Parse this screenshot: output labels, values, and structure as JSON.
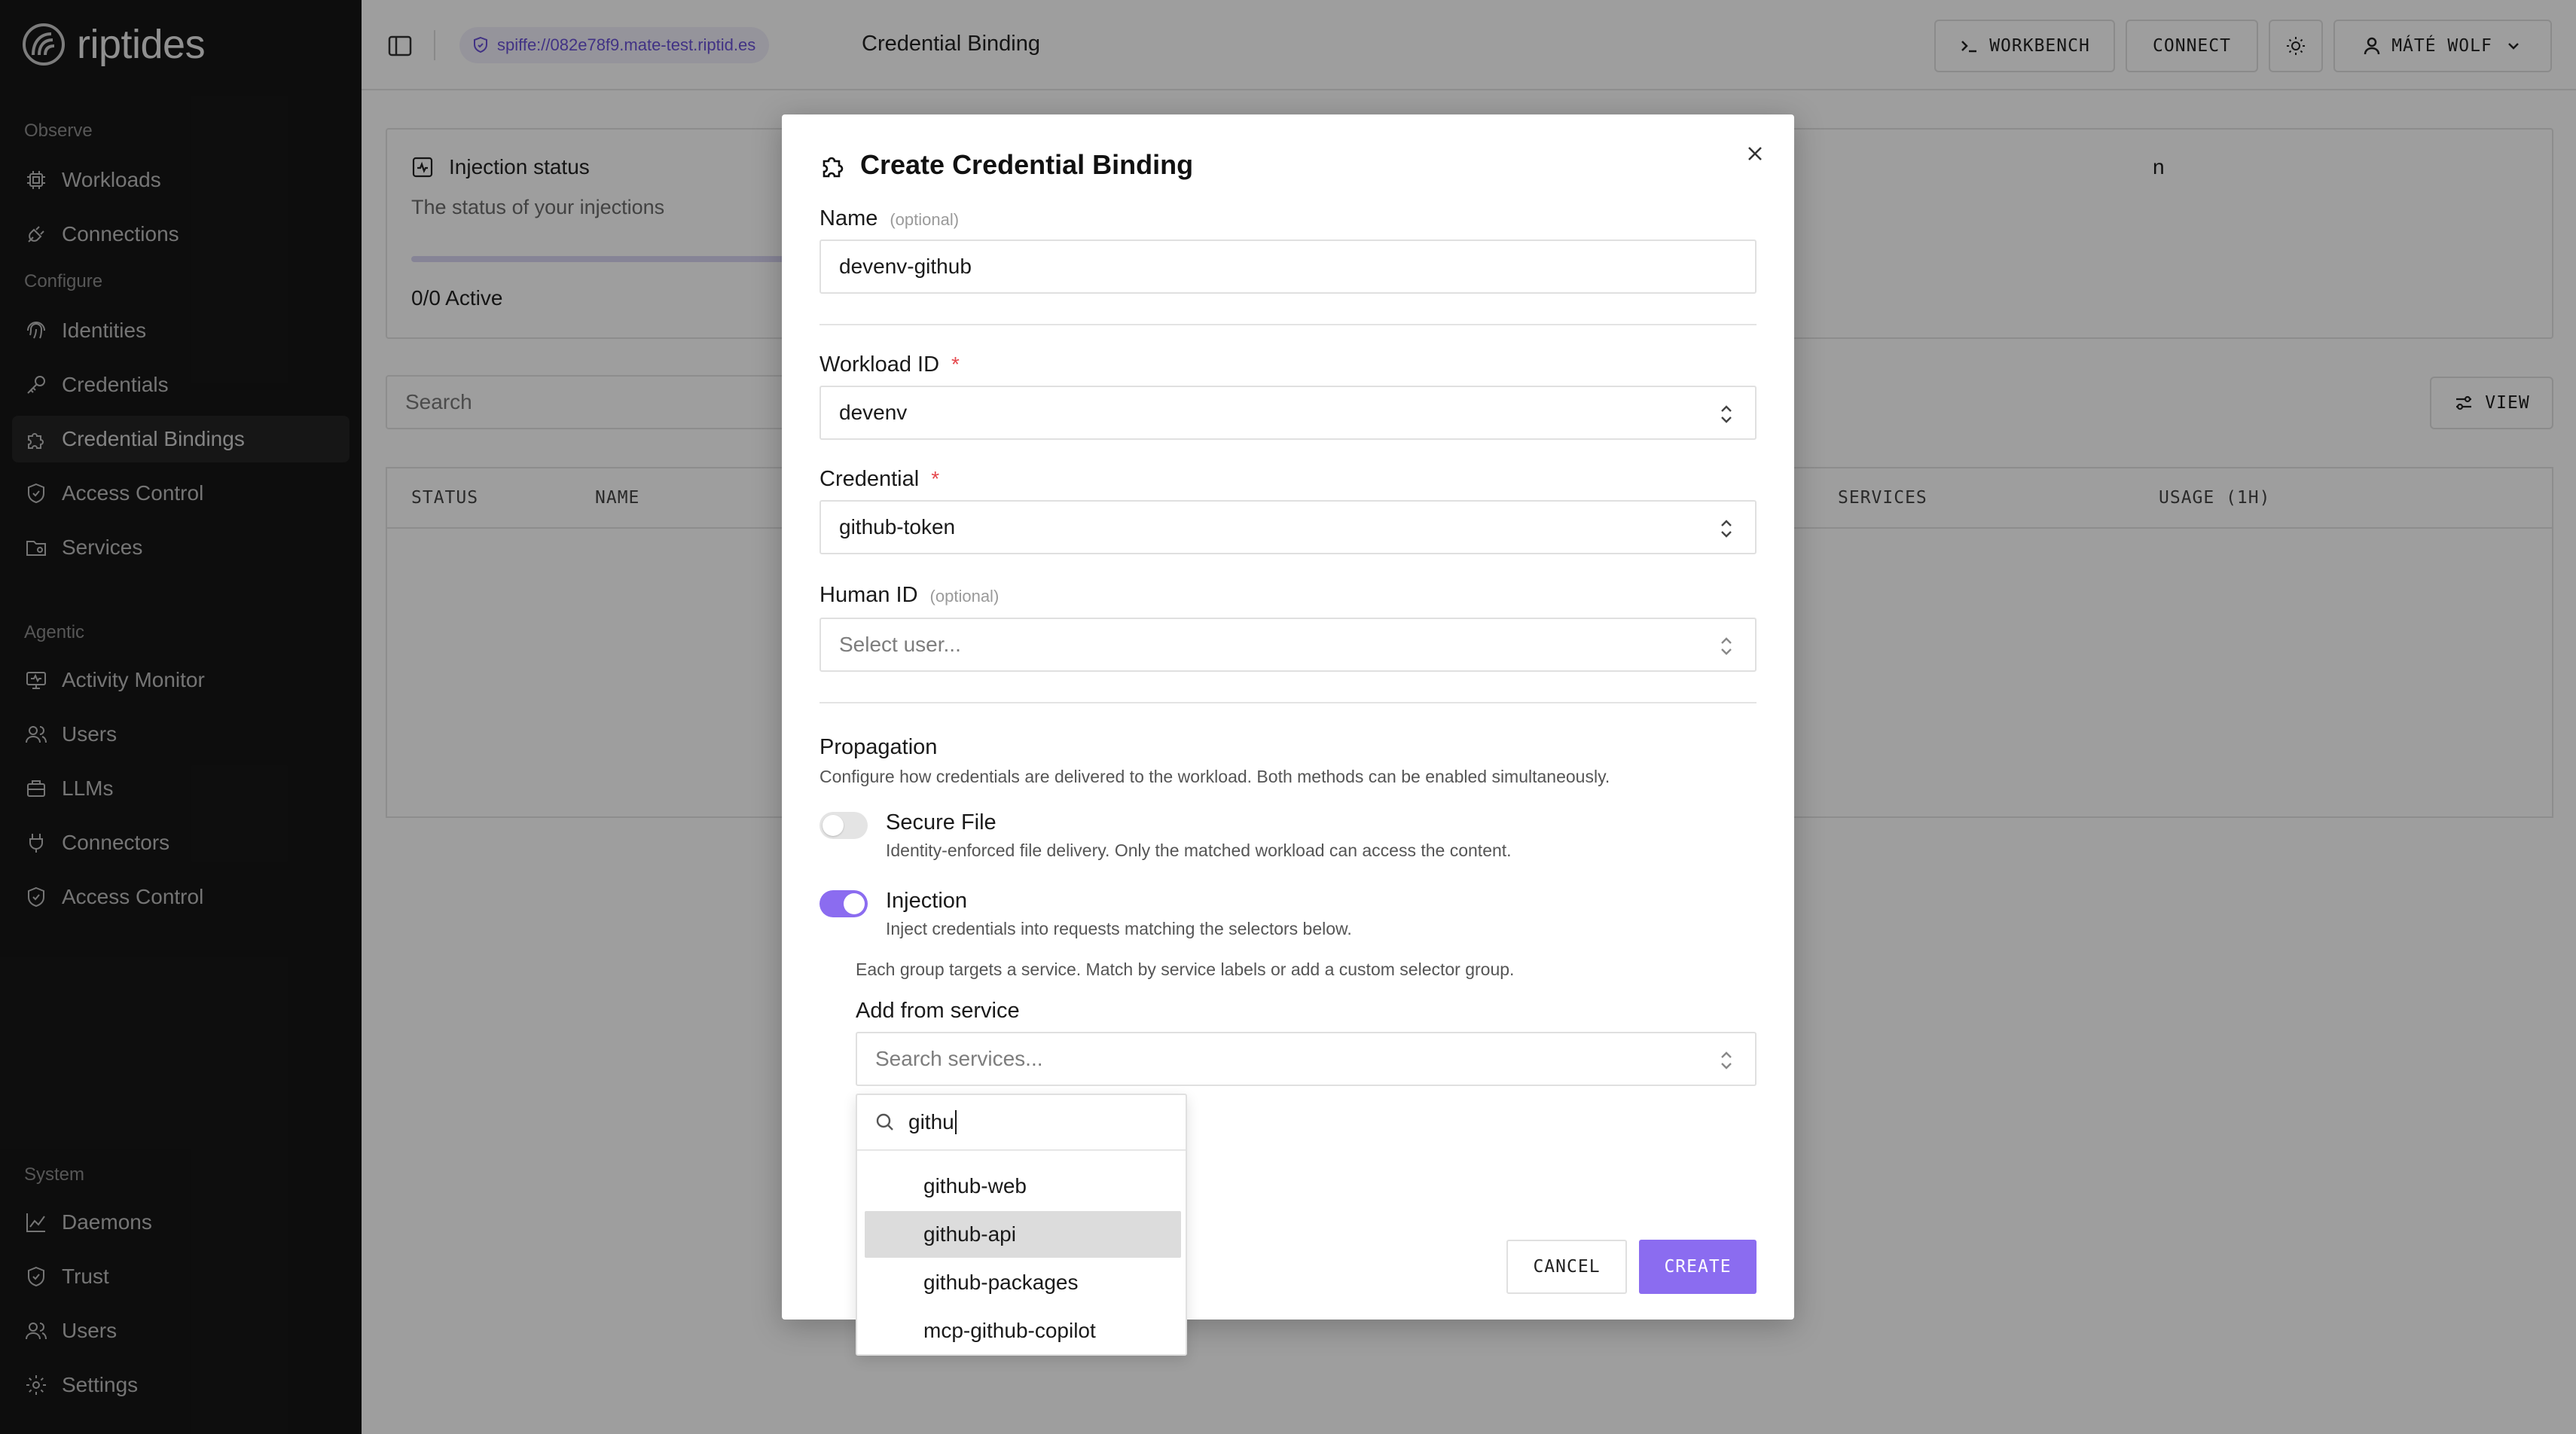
{
  "sidebar": {
    "logo": "riptides",
    "sections": {
      "observe": "Observe",
      "configure": "Configure",
      "agentic": "Agentic",
      "system": "System"
    },
    "observe_items": [
      {
        "label": "Workloads",
        "icon": "cpu-icon"
      },
      {
        "label": "Connections",
        "icon": "plug-icon"
      }
    ],
    "configure_items": [
      {
        "label": "Identities",
        "icon": "fingerprint-icon"
      },
      {
        "label": "Credentials",
        "icon": "key-icon"
      },
      {
        "label": "Credential Bindings",
        "icon": "puzzle-icon",
        "active": true
      },
      {
        "label": "Access Control",
        "icon": "shield-icon"
      },
      {
        "label": "Services",
        "icon": "folder-icon"
      }
    ],
    "agentic_items": [
      {
        "label": "Activity Monitor",
        "icon": "monitor-icon"
      },
      {
        "label": "Users",
        "icon": "users-icon"
      },
      {
        "label": "LLMs",
        "icon": "box-icon"
      },
      {
        "label": "Connectors",
        "icon": "plug-icon"
      },
      {
        "label": "Access Control",
        "icon": "shield-icon"
      }
    ],
    "system_items": [
      {
        "label": "Daemons",
        "icon": "chart-icon"
      },
      {
        "label": "Trust",
        "icon": "shield-icon"
      },
      {
        "label": "Users",
        "icon": "users-icon"
      },
      {
        "label": "Settings",
        "icon": "gear-icon"
      }
    ]
  },
  "topbar": {
    "spiffe_id": "spiffe://082e78f9.mate-test.riptid.es",
    "page_title": "Credential Binding",
    "workbench_label": "WORKBENCH",
    "connect_label": "CONNECT",
    "user_label": "MÁTÉ WOLF"
  },
  "page": {
    "injection_card": {
      "title": "Injection status",
      "subtitle": "The status of your injections",
      "count": "0/0 Active",
      "active_fraction": 0
    },
    "second_card_title_fragment": "n",
    "search_placeholder": "Search",
    "view_label": "VIEW",
    "table_headers": {
      "status": "STATUS",
      "name": "NAME",
      "services": "SERVICES",
      "usage": "USAGE (1H)"
    }
  },
  "modal": {
    "title": "Create Credential Binding",
    "name_label": "Name",
    "optional_text": "(optional)",
    "name_value": "devenv-github",
    "workload_label": "Workload ID",
    "required_mark": "*",
    "workload_value": "devenv",
    "credential_label": "Credential",
    "credential_value": "github-token",
    "human_label": "Human ID",
    "human_placeholder": "Select user...",
    "propagation_title": "Propagation",
    "propagation_desc": "Configure how credentials are delivered to the workload. Both methods can be enabled simultaneously.",
    "secure_file": {
      "label": "Secure File",
      "desc": "Identity-enforced file delivery. Only the matched workload can access the content.",
      "enabled": false
    },
    "injection": {
      "label": "Injection",
      "desc": "Inject credentials into requests matching the selectors below.",
      "enabled": true
    },
    "injection_note": "Each group targets a service. Match by service labels or add a custom selector group.",
    "add_from_service_label": "Add from service",
    "service_search_placeholder": "Search services...",
    "cancel_label": "CANCEL",
    "create_label": "CREATE"
  },
  "dropdown": {
    "query": "githu",
    "options": [
      "github-web",
      "github-api",
      "github-packages",
      "mcp-github-copilot"
    ],
    "highlighted_index": 1
  },
  "colors": {
    "accent": "#8b6cf0",
    "sidebar_bg": "#161616",
    "overlay": "rgba(0,0,0,0.38)"
  }
}
